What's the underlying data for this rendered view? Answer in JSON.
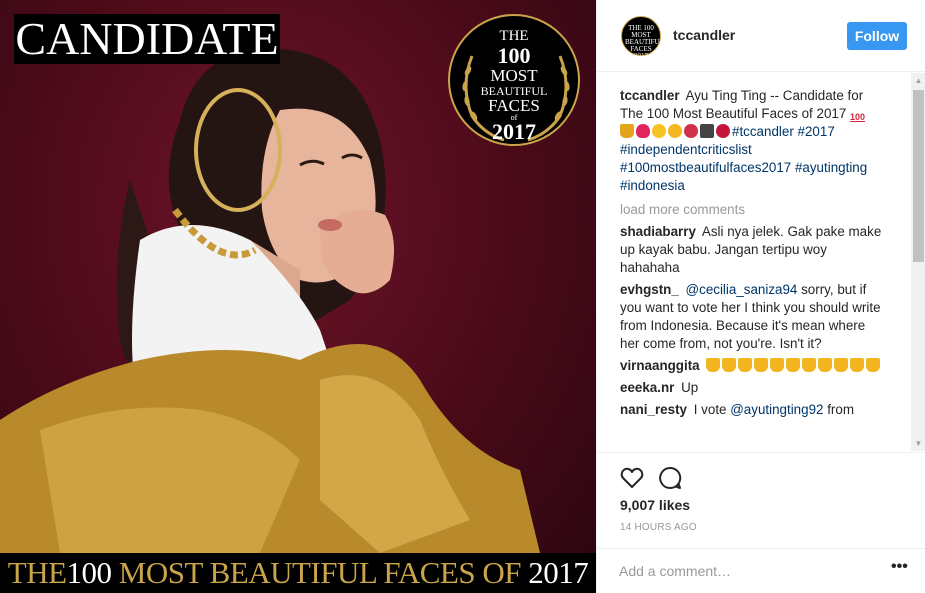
{
  "photo": {
    "candidate_label": "CANDIDATE",
    "badge": {
      "the": "THE",
      "number": "100",
      "most": "MOST",
      "beautiful": "BEAUTIFUL",
      "faces": "FACES",
      "of": "of",
      "year": "2017"
    },
    "bottom_banner": {
      "the": "THE",
      "number": "100",
      "middle": "MOST BEAUTIFUL FACES OF",
      "year": "2017"
    }
  },
  "post": {
    "username": "tccandler",
    "avatar_text": "THE 100 MOST BEAUTIFUL FACES 2017",
    "follow_label": "Follow"
  },
  "caption": {
    "user": "tccandler",
    "text": "Ayu Ting Ting -- Candidate for The 100 Most Beautiful Faces of 2017",
    "hundred_emoji": "100",
    "hashtags": [
      "#tccandler",
      "#2017",
      "#independentcriticslist",
      "#100mostbeautifulfaces2017",
      "#ayutingting",
      "#indonesia"
    ]
  },
  "load_more": "load more comments",
  "comments": [
    {
      "user": "shadiabarry",
      "text": "Asli nya jelek. Gak pake make up kayak babu. Jangan tertipu woy hahahaha"
    },
    {
      "user": "evhgstn_",
      "mention": "@cecilia_saniza94",
      "text": " sorry, but if you want to vote her I think you should write from Indonesia. Because it's mean where her come from, not you're. Isn't it?"
    },
    {
      "user": "virnaanggita",
      "thumbs_down_count": 11
    },
    {
      "user": "eeeka.nr",
      "text": "Up"
    },
    {
      "user": "nani_resty",
      "text": "I vote ",
      "mention": "@ayutingting92",
      "text_after": " from"
    }
  ],
  "likes": "9,007 likes",
  "timestamp": "14 HOURS AGO",
  "comment_input": {
    "placeholder": "Add a comment…"
  },
  "icons": {
    "like": "heart-outline-icon",
    "comment": "speech-bubble-icon",
    "more": "more-options-icon"
  },
  "colors": {
    "follow_button": "#3897f0",
    "hashtag": "#003569",
    "gold": "#c9a44a",
    "photo_bg": "#5a0c1e"
  }
}
